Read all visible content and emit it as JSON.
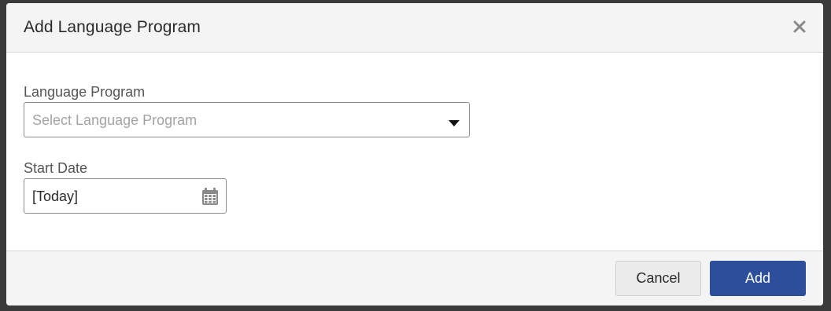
{
  "dialog": {
    "title": "Add Language Program",
    "close_icon": "close-icon"
  },
  "form": {
    "language_program": {
      "label": "Language Program",
      "placeholder": "Select Language Program",
      "icon": "caret-down-icon"
    },
    "start_date": {
      "label": "Start Date",
      "value": "[Today]",
      "icon": "calendar-icon"
    }
  },
  "footer": {
    "cancel_label": "Cancel",
    "add_label": "Add"
  },
  "colors": {
    "primary": "#2d4f9b",
    "header_bg": "#f4f4f4",
    "backdrop": "#3a3a3a"
  }
}
